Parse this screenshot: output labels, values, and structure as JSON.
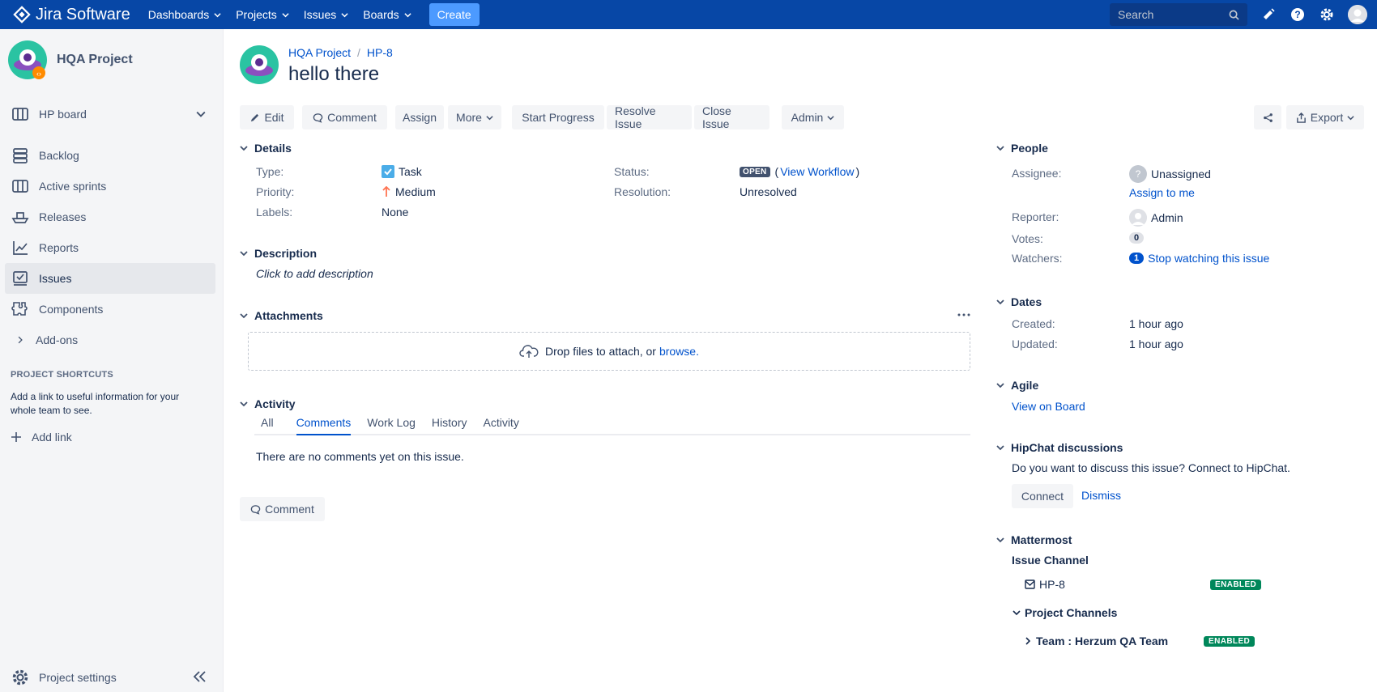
{
  "topbar": {
    "logo_text": "Jira Software",
    "nav": [
      {
        "label": "Dashboards"
      },
      {
        "label": "Projects"
      },
      {
        "label": "Issues"
      },
      {
        "label": "Boards"
      }
    ],
    "create_label": "Create",
    "search_placeholder": "Search"
  },
  "sidebar": {
    "project_name": "HQA Project",
    "board_label": "HP board",
    "items": [
      {
        "label": "Backlog",
        "icon": "backlog-icon"
      },
      {
        "label": "Active sprints",
        "icon": "sprints-icon"
      },
      {
        "label": "Releases",
        "icon": "releases-icon"
      },
      {
        "label": "Reports",
        "icon": "reports-icon"
      },
      {
        "label": "Issues",
        "icon": "issues-icon",
        "active": true
      },
      {
        "label": "Components",
        "icon": "components-icon"
      },
      {
        "label": "Add-ons",
        "icon": "chevron-right-icon"
      }
    ],
    "shortcuts_title": "PROJECT SHORTCUTS",
    "shortcuts_text": "Add a link to useful information for your whole team to see.",
    "add_link_label": "Add link",
    "settings_label": "Project settings"
  },
  "issue": {
    "breadcrumb_project": "HQA Project",
    "breadcrumb_sep": "/",
    "key": "HP-8",
    "title": "hello there"
  },
  "toolbar": {
    "edit": "Edit",
    "comment": "Comment",
    "assign": "Assign",
    "more": "More",
    "start_progress": "Start Progress",
    "resolve": "Resolve Issue",
    "close": "Close Issue",
    "admin": "Admin",
    "export": "Export"
  },
  "details": {
    "title": "Details",
    "type_label": "Type:",
    "type_value": "Task",
    "priority_label": "Priority:",
    "priority_value": "Medium",
    "labels_label": "Labels:",
    "labels_value": "None",
    "status_label": "Status:",
    "status_value": "OPEN",
    "view_workflow_open": "(",
    "view_workflow": "View Workflow",
    "view_workflow_close": ")",
    "resolution_label": "Resolution:",
    "resolution_value": "Unresolved"
  },
  "description": {
    "title": "Description",
    "placeholder": "Click to add description"
  },
  "attachments": {
    "title": "Attachments",
    "drop_text": "Drop files to attach, or",
    "browse": "browse."
  },
  "activity": {
    "title": "Activity",
    "tabs": [
      "All",
      "Comments",
      "Work Log",
      "History",
      "Activity"
    ],
    "active_tab": "Comments",
    "empty_text": "There are no comments yet on this issue.",
    "comment_button": "Comment"
  },
  "people": {
    "title": "People",
    "assignee_label": "Assignee:",
    "assignee_value": "Unassigned",
    "assign_to_me": "Assign to me",
    "reporter_label": "Reporter:",
    "reporter_value": "Admin",
    "votes_label": "Votes:",
    "votes_value": "0",
    "watchers_label": "Watchers:",
    "watchers_count": "1",
    "stop_watching": "Stop watching this issue"
  },
  "dates": {
    "title": "Dates",
    "created_label": "Created:",
    "created_value": "1 hour ago",
    "updated_label": "Updated:",
    "updated_value": "1 hour ago"
  },
  "agile": {
    "title": "Agile",
    "link": "View on Board"
  },
  "hipchat": {
    "title": "HipChat discussions",
    "text": "Do you want to discuss this issue? Connect to HipChat.",
    "connect": "Connect",
    "dismiss": "Dismiss"
  },
  "mattermost": {
    "title": "Mattermost",
    "issue_channel_title": "Issue Channel",
    "issue_channel": "HP-8",
    "issue_channel_status": "ENABLED",
    "project_channels_title": "Project Channels",
    "project_channel": "Team : Herzum QA Team",
    "project_channel_status": "ENABLED"
  },
  "colors": {
    "topbar": "#0747a6",
    "create": "#4c9aff",
    "link": "#0052cc",
    "enabled": "#00875a"
  }
}
